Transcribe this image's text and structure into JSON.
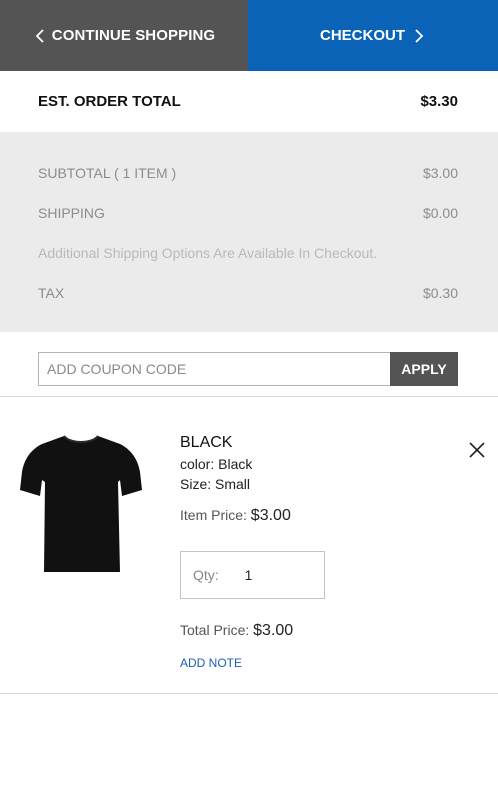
{
  "header": {
    "continue_label": "CONTINUE SHOPPING",
    "checkout_label": "CHECKOUT"
  },
  "order": {
    "est_total_label": "EST. ORDER TOTAL",
    "est_total_value": "$3.30"
  },
  "summary": {
    "subtotal_label": "SUBTOTAL ( 1 ITEM )",
    "subtotal_value": "$3.00",
    "shipping_label": "SHIPPING",
    "shipping_value": "$0.00",
    "shipping_note": "Additional Shipping Options Are Available In Checkout.",
    "tax_label": "TAX",
    "tax_value": "$0.30"
  },
  "coupon": {
    "placeholder": "ADD COUPON CODE",
    "apply_label": "APPLY"
  },
  "item": {
    "name": "BLACK",
    "color": "color: Black",
    "size": "Size: Small",
    "item_price_label": "Item Price:",
    "item_price_value": "$3.00",
    "qty_label": "Qty:",
    "qty_value": "1",
    "total_price_label": "Total Price:",
    "total_price_value": "$3.00",
    "add_note_label": "ADD NOTE",
    "image_icon": "black-tshirt"
  },
  "colors": {
    "continue_bg": "#545454",
    "checkout_bg": "#0a63b6",
    "summary_bg": "#ebebeb",
    "link": "#1b5fb5"
  }
}
